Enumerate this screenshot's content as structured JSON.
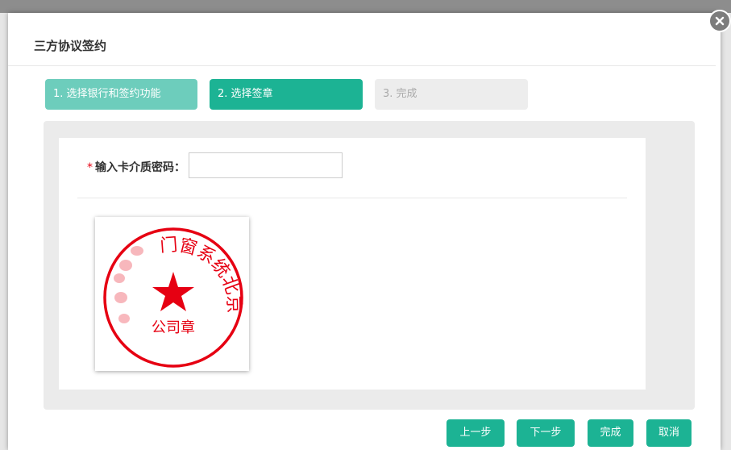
{
  "dialog": {
    "title": "三方协议签约"
  },
  "steps": [
    {
      "label": "1. 选择银行和签约功能",
      "state": "done"
    },
    {
      "label": "2. 选择签章",
      "state": "active"
    },
    {
      "label": "3. 完成",
      "state": "pending"
    }
  ],
  "form": {
    "required_mark": "*",
    "password_label": "输入卡介质密码：",
    "password_value": ""
  },
  "seal": {
    "ring_text": "门窗系统北京",
    "center_text": "公司章",
    "color": "#e60012"
  },
  "buttons": {
    "prev": "上一步",
    "next": "下一步",
    "done": "完成",
    "cancel": "取消"
  },
  "colors": {
    "accent": "#1cb394",
    "accent_light": "#6dcdbc",
    "inactive": "#ededed"
  },
  "icons": {
    "close": "close-icon",
    "star": "star-icon"
  }
}
